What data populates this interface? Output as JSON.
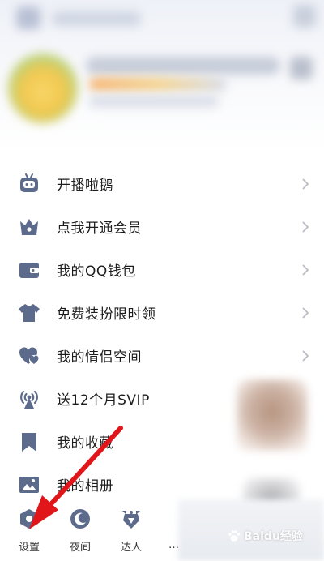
{
  "menu": {
    "items": [
      {
        "label": "开播啦鹅",
        "icon": "robot-tv-icon",
        "chevron": true
      },
      {
        "label": "点我开通会员",
        "icon": "crown-icon",
        "chevron": true
      },
      {
        "label": "我的QQ钱包",
        "icon": "wallet-icon",
        "chevron": true
      },
      {
        "label": "免费装扮限时领",
        "icon": "shirt-icon",
        "chevron": true
      },
      {
        "label": "我的情侣空间",
        "icon": "couple-heart-icon",
        "chevron": true
      },
      {
        "label": "送12个月SVIP",
        "icon": "broadcast-antenna-icon",
        "chevron": false
      },
      {
        "label": "我的收藏",
        "icon": "bookmark-icon",
        "chevron": false
      },
      {
        "label": "我的相册",
        "icon": "photo-album-icon",
        "chevron": false
      }
    ]
  },
  "bottom_bar": {
    "tabs": [
      {
        "label": "设置",
        "icon": "settings-hexagon-icon"
      },
      {
        "label": "夜间",
        "icon": "moon-icon"
      },
      {
        "label": "达人",
        "icon": "daren-badge-icon"
      },
      {
        "label": "…"
      }
    ]
  },
  "watermark": {
    "text": "Baidu经验"
  },
  "colors": {
    "icon": "#5c6a8c",
    "chevron": "#b9bcc4",
    "arrow": "#e0161a"
  }
}
